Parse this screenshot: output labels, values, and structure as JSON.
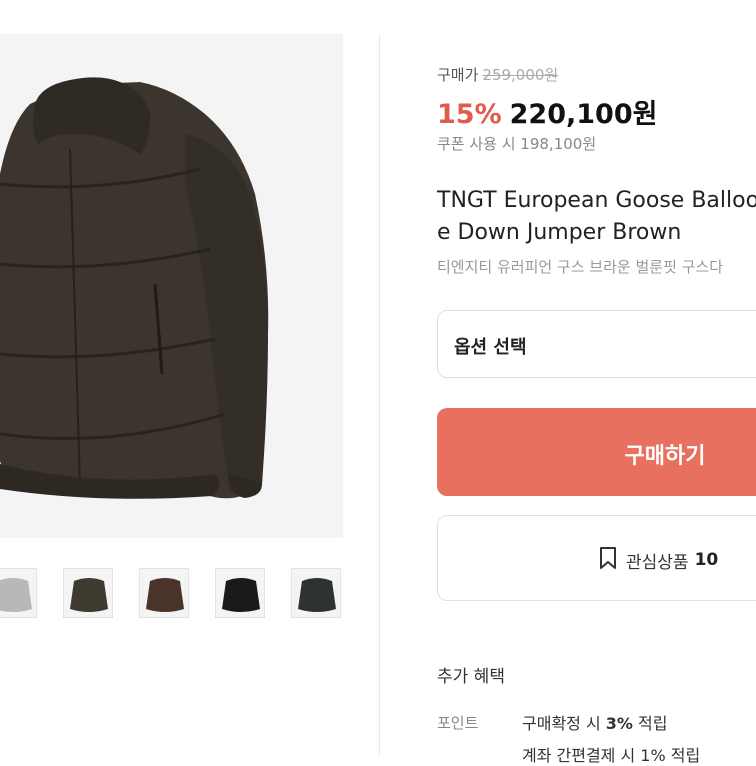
{
  "price": {
    "label": "구매가",
    "original": "259,000원",
    "discount": "15%",
    "final": "220,100원",
    "coupon": "쿠폰 사용 시 198,100원"
  },
  "product": {
    "title_line1": "TNGT European Goose Balloo",
    "title_line2": "e Down Jumper Brown",
    "subtitle": "티엔지티 유러피언 구스 브라운 벌룬핏 구스다"
  },
  "option": {
    "label": "옵션 선택"
  },
  "buy": {
    "label": "구매하기"
  },
  "wishlist": {
    "icon": "bookmark-icon",
    "label": "관심상품",
    "count": "10"
  },
  "benefits": {
    "title": "추가 혜택",
    "point_label": "포인트",
    "point_prefix": "구매확정 시",
    "point_rate": "3%",
    "point_suffix": "적립",
    "extra_text": "계좌 간편결제 시 1% 적립"
  },
  "colors": {
    "accent": "#e8705e",
    "discount": "#e05c4b",
    "jacket_brown": "#3a342d"
  },
  "gallery": {
    "thumbnails": [
      "light-gray-jacket",
      "olive-brown-jacket",
      "brown-jacket",
      "black-jacket",
      "charcoal-jacket"
    ]
  }
}
